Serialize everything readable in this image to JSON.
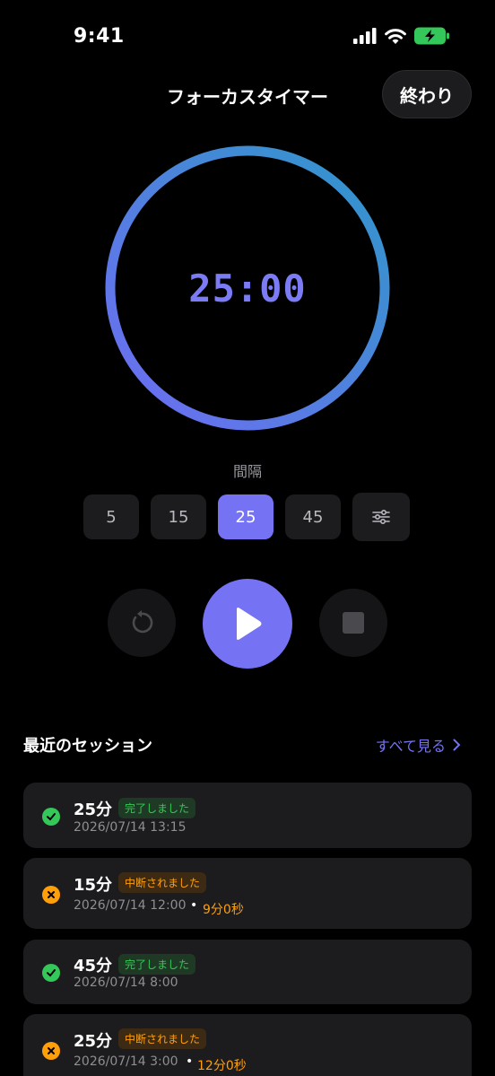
{
  "status": {
    "time": "9:41"
  },
  "header": {
    "title": "フォーカスタイマー",
    "done_label": "終わり"
  },
  "timer": {
    "display": "25:00",
    "progress": 1.0
  },
  "interval": {
    "label": "間隔",
    "options": [
      "5",
      "15",
      "25",
      "45"
    ],
    "selected": "25"
  },
  "controls": {
    "reset": "reset-icon",
    "play": "play-icon",
    "stop": "stop-icon"
  },
  "recent": {
    "title": "最近のセッション",
    "see_all": "すべて見る",
    "sessions": [
      {
        "duration": "25分",
        "status": "完了しました",
        "state": "completed",
        "date": "2026/07/14 13:15",
        "elapsed": ""
      },
      {
        "duration": "15分",
        "status": "中断されました",
        "state": "interrupted",
        "date": "2026/07/14 12:00",
        "elapsed": "9分0秒"
      },
      {
        "duration": "45分",
        "status": "完了しました",
        "state": "completed",
        "date": "2026/07/14 8:00",
        "elapsed": ""
      },
      {
        "duration": "25分",
        "status": "中断されました",
        "state": "interrupted",
        "date": "2026/07/14 3:00",
        "elapsed": "12分0秒"
      }
    ]
  },
  "colors": {
    "accent": "#7573f4",
    "ring_start": "#6f6cf3",
    "ring_end": "#2f97c9",
    "success": "#34c759",
    "warning": "#ff9f0a"
  }
}
